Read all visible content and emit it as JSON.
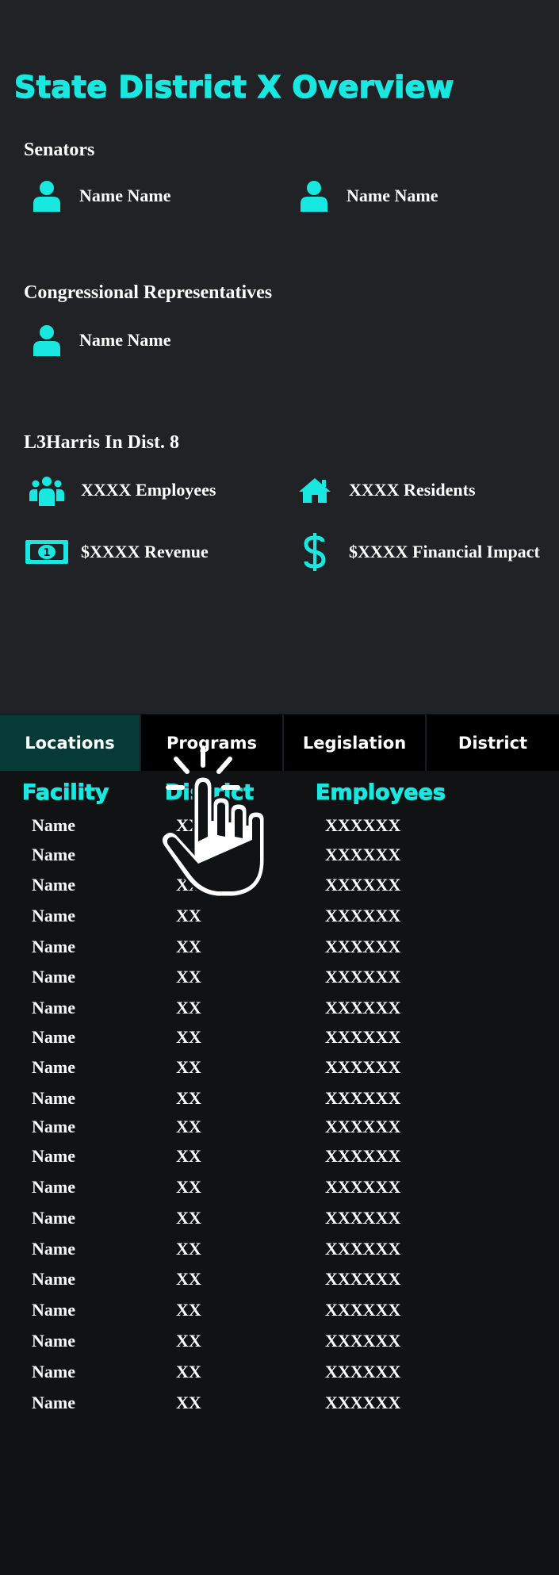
{
  "title": "State District X Overview",
  "senators": {
    "heading": "Senators",
    "people": [
      {
        "name": "Name Name",
        "icon": "person-icon"
      },
      {
        "name": "Name Name",
        "icon": "person-icon"
      }
    ]
  },
  "representatives": {
    "heading": "Congressional Representatives",
    "people": [
      {
        "name": "Name Name",
        "icon": "person-icon"
      }
    ]
  },
  "company": {
    "heading": "L3Harris In Dist. 8",
    "stats": [
      {
        "label": "XXXX Employees",
        "icon": "group-icon"
      },
      {
        "label": "XXXX Residents",
        "icon": "home-icon"
      },
      {
        "label": "$XXXX Revenue",
        "icon": "money-bill-icon"
      },
      {
        "label": "$XXXX Financial Impact",
        "icon": "dollar-sign-icon"
      }
    ]
  },
  "tabs": [
    {
      "label": "Locations",
      "active": true
    },
    {
      "label": "Programs",
      "active": false
    },
    {
      "label": "Legislation",
      "active": false
    },
    {
      "label": "District",
      "active": false
    }
  ],
  "table": {
    "columns": [
      "Facility",
      "District",
      "Employees"
    ],
    "rows": [
      [
        "Name",
        "XX",
        "XXXXXX"
      ],
      [
        "Name",
        "XX",
        "XXXXXX"
      ],
      [
        "Name",
        "XX",
        "XXXXXX"
      ],
      [
        "Name",
        "XX",
        "XXXXXX"
      ],
      [
        "Name",
        "XX",
        "XXXXXX"
      ],
      [
        "Name",
        "XX",
        "XXXXXX"
      ],
      [
        "Name",
        "XX",
        "XXXXXX"
      ],
      [
        "Name",
        "XX",
        "XXXXXX"
      ],
      [
        "Name",
        "XX",
        "XXXXXX"
      ],
      [
        "Name",
        "XX",
        "XXXXXX"
      ],
      [
        "Name",
        "XX",
        "XXXXXX"
      ],
      [
        "Name",
        "XX",
        "XXXXXX"
      ],
      [
        "Name",
        "XX",
        "XXXXXX"
      ],
      [
        "Name",
        "XX",
        "XXXXXX"
      ],
      [
        "Name",
        "XX",
        "XXXXXX"
      ],
      [
        "Name",
        "XX",
        "XXXXXX"
      ],
      [
        "Name",
        "XX",
        "XXXXXX"
      ],
      [
        "Name",
        "XX",
        "XXXXXX"
      ],
      [
        "Name",
        "XX",
        "XXXXXX"
      ],
      [
        "Name",
        "XX",
        "XXXXXX"
      ]
    ]
  },
  "colors": {
    "accent": "#18e8e0",
    "background": "#212226",
    "table_background": "#111214",
    "active_tab": "#063a36"
  },
  "overlay": {
    "icon": "tap-hand-icon"
  }
}
